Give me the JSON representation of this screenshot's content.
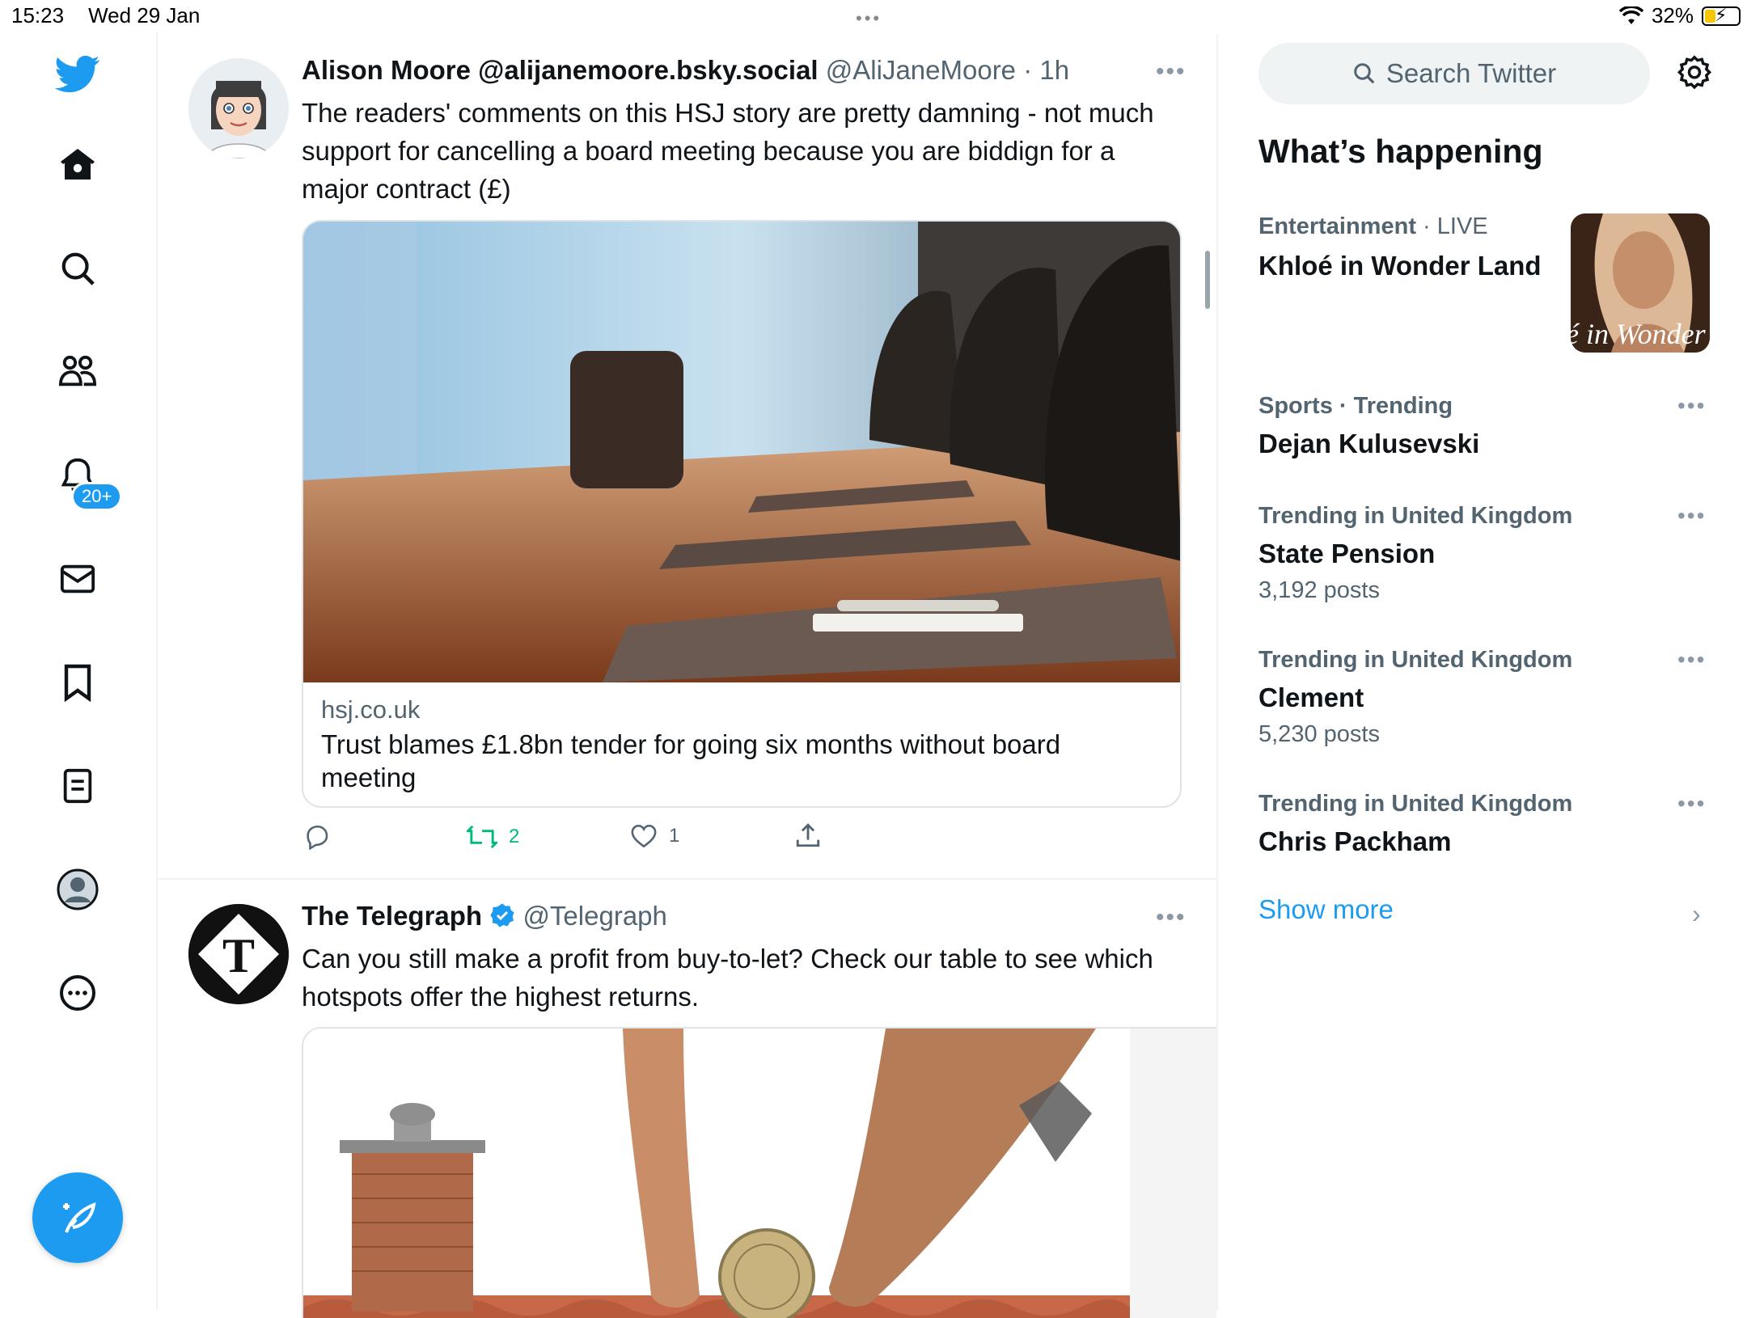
{
  "status_bar": {
    "time": "15:23",
    "date": "Wed 29 Jan",
    "battery": "32%"
  },
  "nav": {
    "notifications_badge": "20+",
    "items": [
      "twitter-logo",
      "home-icon",
      "search-icon",
      "communities-icon",
      "bell-icon",
      "mail-icon",
      "bookmark-icon",
      "lists-icon",
      "profile-icon",
      "more-circle-icon"
    ]
  },
  "tweets": [
    {
      "name": "Alison Moore @alijanemoore.bsky.social",
      "handle": "@AliJaneMoore · 1h",
      "text": "The readers' comments on this HSJ story are pretty damning - not much support for cancelling a board meeting because you are biddign for a major contract (£)",
      "card": {
        "domain": "hsj.co.uk",
        "title": "Trust blames £1.8bn tender for going six months without board meeting"
      },
      "retweets": "2",
      "likes": "1"
    },
    {
      "name": "The Telegraph",
      "handle": "@Telegraph",
      "text": "Can you still make a profit from buy-to-let? Check our table to see which hotspots offer the highest returns."
    }
  ],
  "sidebar": {
    "search_placeholder": "Search Twitter",
    "title": "What’s happening",
    "trends": [
      {
        "category": "Entertainment",
        "extra": "LIVE",
        "name": "Khloé in Wonder Land",
        "image_text": "é in Wonder l"
      },
      {
        "category": "Sports · Trending",
        "name": "Dejan Kulusevski"
      },
      {
        "category": "Trending in United Kingdom",
        "name": "State Pension",
        "count": "3,192 posts"
      },
      {
        "category": "Trending in United Kingdom",
        "name": "Clement",
        "count": "5,230 posts"
      },
      {
        "category": "Trending in United Kingdom",
        "name": "Chris Packham"
      }
    ],
    "show_more": "Show more"
  },
  "colors": {
    "accent": "#1d9bf0",
    "retweet": "#00ba7c",
    "text": "#0f1419",
    "secondary": "#536471"
  }
}
